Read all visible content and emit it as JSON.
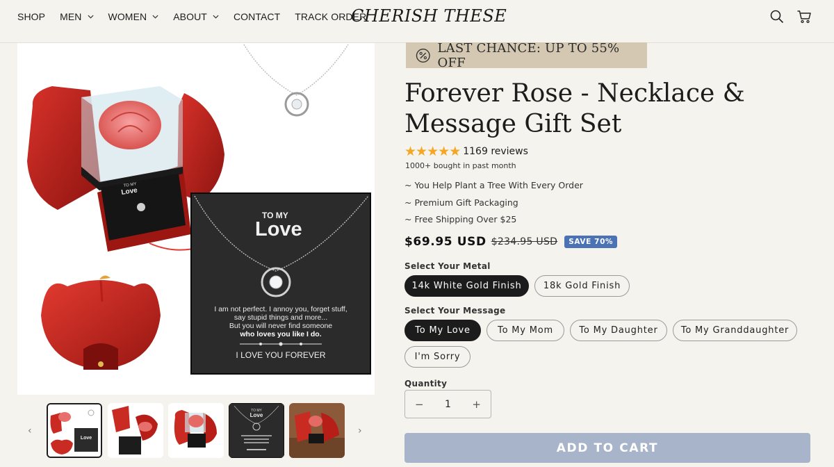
{
  "nav": {
    "items": [
      {
        "label": "SHOP",
        "dropdown": false
      },
      {
        "label": "MEN",
        "dropdown": true
      },
      {
        "label": "WOMEN",
        "dropdown": true
      },
      {
        "label": "ABOUT",
        "dropdown": true
      },
      {
        "label": "CONTACT",
        "dropdown": false
      },
      {
        "label": "TRACK ORDER",
        "dropdown": false
      }
    ],
    "logo": "CHERISH THESE",
    "icons": [
      "search-icon",
      "cart-icon"
    ]
  },
  "gallery": {
    "main_image": {
      "box_card_heading_small": "TO MY",
      "box_card_heading": "Love",
      "card_heading_small": "TO MY",
      "card_heading": "Love",
      "card_lines": [
        "I am not perfect. I annoy you, forget stuff,",
        "say stupid things and more...",
        "But you will never find someone",
        "who loves you like I do."
      ],
      "card_footer": "I LOVE YOU FOREVER"
    },
    "thumbnails": 5,
    "thumb_card_small": "TO MY",
    "thumb_card_heading": "Love"
  },
  "product": {
    "badge": "LAST CHANCE: UP TO 55% OFF",
    "title": "Forever Rose - Necklace & Message Gift Set",
    "rating": 5,
    "reviews": "1169 reviews",
    "bought": "1000+ bought in past month",
    "perks": [
      "~ You Help Plant a Tree With Every Order",
      "~ Premium Gift Packaging",
      "~ Free Shipping Over $25"
    ],
    "price": "$69.95 USD",
    "compare_price": "$234.95 USD",
    "save": "SAVE 70%",
    "metal_label": "Select Your Metal",
    "metals": [
      "14k White Gold Finish",
      "18k Gold Finish"
    ],
    "message_label": "Select Your Message",
    "messages": [
      "To My Love",
      "To My Mom",
      "To My Daughter",
      "To My Granddaughter",
      "I'm Sorry"
    ],
    "quantity_label": "Quantity",
    "quantity": "1",
    "minus": "−",
    "plus": "+",
    "add_to_cart": "ADD TO CART"
  },
  "colors": {
    "background": "#f4f3ee",
    "badge": "#d4c8b3",
    "star": "#f5a623",
    "save_badge": "#4a72b5",
    "add_to_cart": "#a8b4ca",
    "selected_pill": "#1c1c1c"
  }
}
